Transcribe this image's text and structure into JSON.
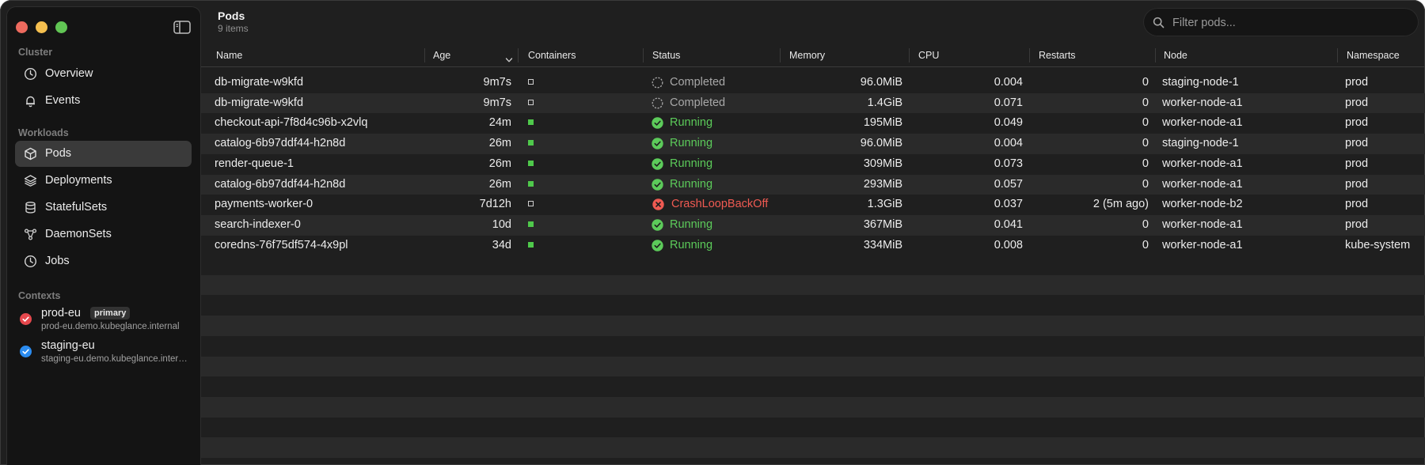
{
  "sidebar": {
    "sections": {
      "cluster": "Cluster",
      "workloads": "Workloads",
      "contexts": "Contexts"
    },
    "cluster_items": [
      {
        "label": "Overview",
        "icon": "overview-icon"
      },
      {
        "label": "Events",
        "icon": "bell-icon"
      }
    ],
    "workload_items": [
      {
        "label": "Pods",
        "icon": "cube-icon",
        "active": true
      },
      {
        "label": "Deployments",
        "icon": "layers-icon"
      },
      {
        "label": "StatefulSets",
        "icon": "database-icon"
      },
      {
        "label": "DaemonSets",
        "icon": "nodes-icon"
      },
      {
        "label": "Jobs",
        "icon": "clock-icon"
      }
    ],
    "contexts": [
      {
        "name": "prod-eu",
        "badge": "primary",
        "host": "prod-eu.demo.kubeglance.internal",
        "color": "#e5484d"
      },
      {
        "name": "staging-eu",
        "badge": "",
        "host": "staging-eu.demo.kubeglance.internal",
        "color": "#2b8cf0"
      }
    ]
  },
  "header": {
    "title": "Pods",
    "subtitle": "9 items"
  },
  "search": {
    "placeholder": "Filter pods..."
  },
  "table": {
    "columns": {
      "name": "Name",
      "age": "Age",
      "containers": "Containers",
      "status": "Status",
      "memory": "Memory",
      "cpu": "CPU",
      "restarts": "Restarts",
      "node": "Node",
      "namespace": "Namespace"
    },
    "rows": [
      {
        "name": "db-migrate-w9kfd",
        "age": "9m7s",
        "container": "empty",
        "status": "Completed",
        "memory": "96.0MiB",
        "cpu": "0.004",
        "restarts": "0",
        "node": "staging-node-1",
        "namespace": "prod"
      },
      {
        "name": "db-migrate-w9kfd",
        "age": "9m7s",
        "container": "empty",
        "status": "Completed",
        "memory": "1.4GiB",
        "cpu": "0.071",
        "restarts": "0",
        "node": "worker-node-a1",
        "namespace": "prod"
      },
      {
        "name": "checkout-api-7f8d4c96b-x2vlq",
        "age": "24m",
        "container": "filled",
        "status": "Running",
        "memory": "195MiB",
        "cpu": "0.049",
        "restarts": "0",
        "node": "worker-node-a1",
        "namespace": "prod"
      },
      {
        "name": "catalog-6b97ddf44-h2n8d",
        "age": "26m",
        "container": "filled",
        "status": "Running",
        "memory": "96.0MiB",
        "cpu": "0.004",
        "restarts": "0",
        "node": "staging-node-1",
        "namespace": "prod"
      },
      {
        "name": "render-queue-1",
        "age": "26m",
        "container": "filled",
        "status": "Running",
        "memory": "309MiB",
        "cpu": "0.073",
        "restarts": "0",
        "node": "worker-node-a1",
        "namespace": "prod"
      },
      {
        "name": "catalog-6b97ddf44-h2n8d",
        "age": "26m",
        "container": "filled",
        "status": "Running",
        "memory": "293MiB",
        "cpu": "0.057",
        "restarts": "0",
        "node": "worker-node-a1",
        "namespace": "prod"
      },
      {
        "name": "payments-worker-0",
        "age": "7d12h",
        "container": "empty",
        "status": "CrashLoopBackOff",
        "memory": "1.3GiB",
        "cpu": "0.037",
        "restarts": "2 (5m ago)",
        "node": "worker-node-b2",
        "namespace": "prod"
      },
      {
        "name": "search-indexer-0",
        "age": "10d",
        "container": "filled",
        "status": "Running",
        "memory": "367MiB",
        "cpu": "0.041",
        "restarts": "0",
        "node": "worker-node-a1",
        "namespace": "prod"
      },
      {
        "name": "coredns-76f75df574-4x9pl",
        "age": "34d",
        "container": "filled",
        "status": "Running",
        "memory": "334MiB",
        "cpu": "0.008",
        "restarts": "0",
        "node": "worker-node-a1",
        "namespace": "kube-system"
      }
    ]
  },
  "colors": {
    "running": "#5ccb5a",
    "completed": "#a8a8a8",
    "crash": "#ef5a52",
    "container_running": "#4fc94b"
  }
}
